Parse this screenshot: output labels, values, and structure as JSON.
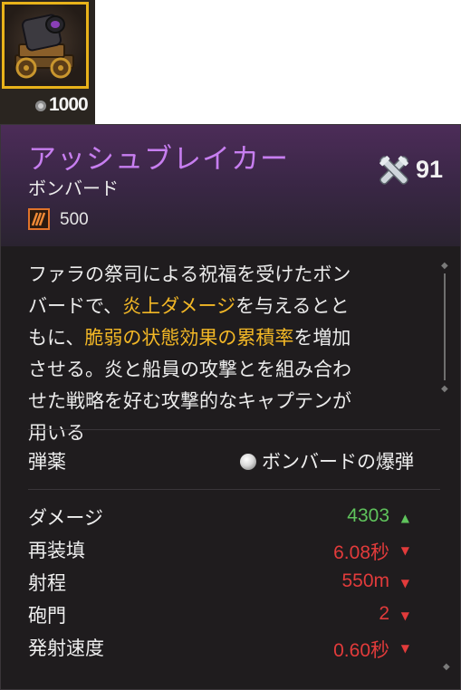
{
  "top_item": {
    "price": "1000",
    "icon": "cannon-icon"
  },
  "tooltip": {
    "title": "アッシュブレイカー",
    "subtitle": "ボンバード",
    "stat_icon": "fire-damage-icon",
    "stat_value": "500",
    "level_icon": "crossed-cannons-icon",
    "level_value": "91",
    "description": {
      "line1": "ファラの祭司による祝福を受けたボン",
      "line2_pre": "バードで、",
      "line2_hl": "炎上ダメージ",
      "line2_post": "を与えるとと",
      "line3_pre": "もに、",
      "line3_hl": "脆弱の状態効果の累積率",
      "line3_post": "を増加",
      "line4": "させる。炎と船員の攻撃とを組み合わ",
      "line5": "せた戦略を好む攻撃的なキャプテンが",
      "line6": "用いる"
    },
    "ammo": {
      "label": "弾薬",
      "value": "ボンバードの爆弾",
      "icon": "bomb-icon"
    },
    "stats": [
      {
        "label": "ダメージ",
        "value": "4303",
        "trend": "up",
        "color": "#5fc35c"
      },
      {
        "label": "再装填",
        "value": "6.08秒",
        "trend": "down",
        "color": "#e23b3b"
      },
      {
        "label": "射程",
        "value": "550m",
        "trend": "down",
        "color": "#e23b3b"
      },
      {
        "label": "砲門",
        "value": "2",
        "trend": "down",
        "color": "#e23b3b"
      },
      {
        "label": "発射速度",
        "value": "0.60秒",
        "trend": "down",
        "color": "#e23b3b"
      }
    ],
    "colors": {
      "title": "#c77ef0",
      "highlight": "#f2b726",
      "slot_border": "#e8b21a"
    }
  }
}
